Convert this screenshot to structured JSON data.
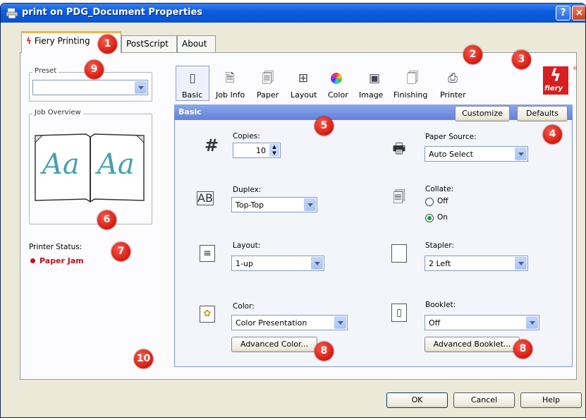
{
  "window": {
    "title": "print on PDG_Document Properties",
    "help_glyph": "?",
    "close_glyph": "×"
  },
  "tabs": [
    {
      "label": "Fiery Printing"
    },
    {
      "label": "PostScript"
    },
    {
      "label": "About"
    }
  ],
  "left_panel": {
    "preset_label": "Preset",
    "preset_value": "",
    "job_overview_label": "Job Overview",
    "preview_text": "Aa",
    "printer_status_label": "Printer Status:",
    "printer_status_value": "Paper Jam",
    "status_color": "#c0141c"
  },
  "toolbar": {
    "items": [
      {
        "label": "Basic",
        "icon": "page-icon"
      },
      {
        "label": "Job Info",
        "icon": "info-icon"
      },
      {
        "label": "Paper",
        "icon": "paper-icon"
      },
      {
        "label": "Layout",
        "icon": "layout-icon"
      },
      {
        "label": "Color",
        "icon": "color-wheel-icon"
      },
      {
        "label": "Image",
        "icon": "image-icon"
      },
      {
        "label": "Finishing",
        "icon": "finishing-icon"
      },
      {
        "label": "Printer",
        "icon": "printer-icon"
      }
    ],
    "selected": "Basic"
  },
  "section": {
    "title": "Basic",
    "customize_label": "Customize",
    "defaults_label": "Defaults",
    "header_color": "#7a96df"
  },
  "settings": {
    "copies_label": "Copies:",
    "copies_value": "10",
    "paper_source_label": "Paper Source:",
    "paper_source_value": "Auto Select",
    "duplex_label": "Duplex:",
    "duplex_value": "Top-Top",
    "collate_label": "Collate:",
    "collate_off_label": "Off",
    "collate_on_label": "On",
    "collate_selected": "On",
    "layout_label": "Layout:",
    "layout_value": "1-up",
    "stapler_label": "Stapler:",
    "stapler_value": "2 Left",
    "color_label": "Color:",
    "color_value": "Color Presentation",
    "advanced_color_label": "Advanced Color...",
    "booklet_label": "Booklet:",
    "booklet_value": "Off",
    "advanced_booklet_label": "Advanced Booklet..."
  },
  "footer": {
    "ok_label": "OK",
    "cancel_label": "Cancel",
    "help_label": "Help"
  },
  "callouts": [
    "1",
    "2",
    "3",
    "4",
    "5",
    "6",
    "7",
    "8",
    "8",
    "9",
    "10"
  ],
  "logo": {
    "text": "fiery",
    "color": "#d81e1e"
  }
}
